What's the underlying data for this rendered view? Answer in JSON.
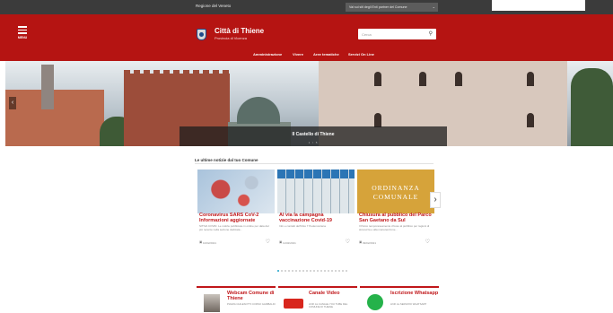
{
  "topbar": {
    "region": "Regione del Veneto",
    "sites": "Vai sui siti degli Enti partner del Comune"
  },
  "header": {
    "menu_label": "MENU",
    "title": "Città di Thiene",
    "subtitle": "Provincia di Vicenza",
    "search_placeholder": "Cerca"
  },
  "nav": [
    "Amministrazione",
    "Vivere",
    "Aree tematiche",
    "Servizi On Line"
  ],
  "hero": {
    "caption": "Il Castello di Thiene",
    "pager": "1 / 5"
  },
  "news_section": {
    "title": "Le ultime notizie dal tuo Comune"
  },
  "cards": [
    {
      "title": "Coronavirus SARS CoV-2 Informazioni aggiornate",
      "excerpt": "SITIVA COVID. Le notizie pubblicate in ordine per data dal più recente nella sezione dedicata...",
      "date": "10/02/2021"
    },
    {
      "title": "Al via la campagna vaccinazione Covid-19",
      "excerpt": "Info e contatti dell'Ulss 7 Pedemontana",
      "date": "11/02/2021"
    },
    {
      "title": "Chiusura al pubblico del Parco San Gaetano da Sul",
      "excerpt": "Il Parco temporaneamente chiuso al pubblico per ragioni di sicurezza e alla manutenzione...",
      "date": "09/02/2021",
      "image_line1": "ORDINANZA",
      "image_line2": "COMUNALE"
    }
  ],
  "pager_count": 20,
  "pager_active": 0,
  "services": [
    {
      "title": "Webcam Comune di Thiene",
      "desc": "PIAZZA CHILESOTTI CORSO GARIBALDI"
    },
    {
      "title": "Canale Video",
      "desc": "LINK AL CANALE YOU TUBE DEL COMUNE DI THIENE"
    },
    {
      "title": "Iscrizione Whatsapp",
      "desc": "LINK AL SERVIZIO WHATSAPP"
    }
  ],
  "colors": {
    "brand_red": "#b51412",
    "link_red": "#c0171a",
    "topbar": "#3b3b3b"
  }
}
